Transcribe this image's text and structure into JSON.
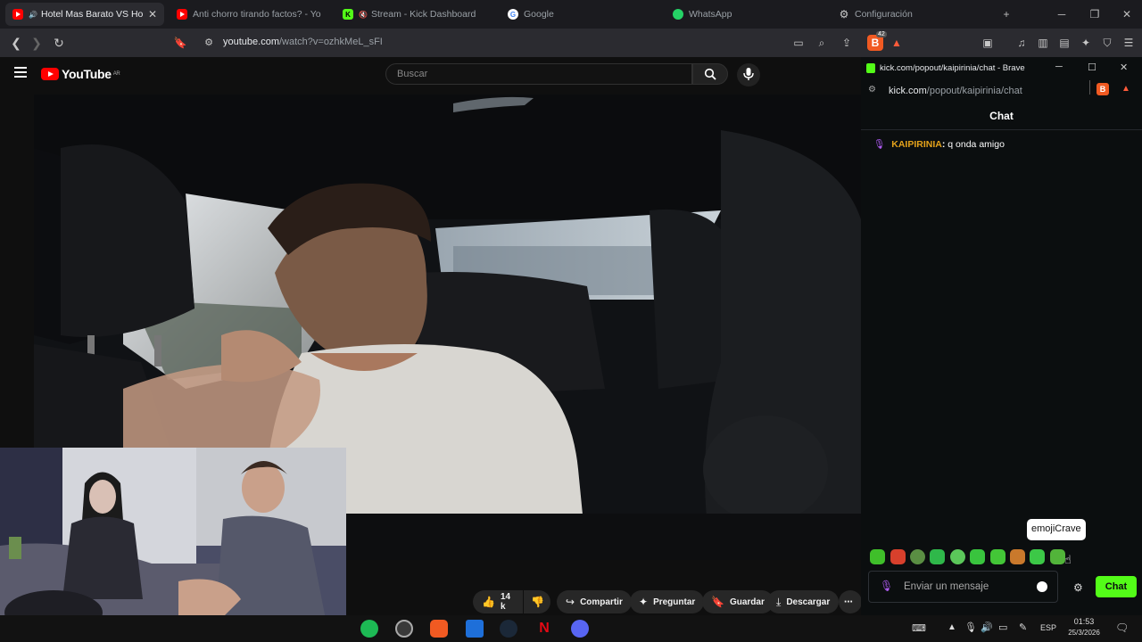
{
  "browser": {
    "tabs": [
      {
        "title": "Hotel Mas Barato VS Hotel",
        "favicon": "youtube-icon",
        "active": true
      },
      {
        "title": "Anti chorro tirando factos? - YouT",
        "favicon": "youtube-icon",
        "active": false
      },
      {
        "title": "Stream - Kick Dashboard",
        "favicon": "kick-icon",
        "active": false
      },
      {
        "title": "Google",
        "favicon": "google-icon",
        "active": false
      },
      {
        "title": "WhatsApp",
        "favicon": "whatsapp-icon",
        "active": false
      },
      {
        "title": "Configuración",
        "favicon": "gear-icon",
        "active": false
      }
    ],
    "new_tab": "+",
    "address": {
      "host": "youtube.com",
      "path": "/watch?v=ozhkMeL_sFI"
    },
    "brave_shield_badge": "42"
  },
  "youtube": {
    "logo_text": "YouTube",
    "country_code": "AR",
    "search_placeholder": "Buscar",
    "actions": {
      "likes": "14 k",
      "share": "Compartir",
      "ask": "Preguntar",
      "save": "Guardar",
      "download": "Descargar"
    }
  },
  "kick_popout": {
    "window_title": "kick.com/popout/kaipirinia/chat - Brave",
    "url_host": "kick.com",
    "url_path": "/popout/kaipirinia/chat",
    "chat_header": "Chat",
    "messages": [
      {
        "user": "KAIPIRINIA",
        "text": "q onda amigo",
        "user_color": "#e4a21b"
      }
    ],
    "emote_tooltip": "emojiCrave",
    "input_placeholder": "Enviar un mensaje",
    "send_button": "Chat",
    "accent": "#53fc18"
  },
  "taskbar": {
    "language": "ESP",
    "time": "01:53",
    "date": "25/3/2026",
    "apps": [
      "spotify-icon",
      "obs-icon",
      "brave-icon",
      "explorer-icon",
      "steam-icon",
      "netflix-icon",
      "discord-icon"
    ]
  }
}
